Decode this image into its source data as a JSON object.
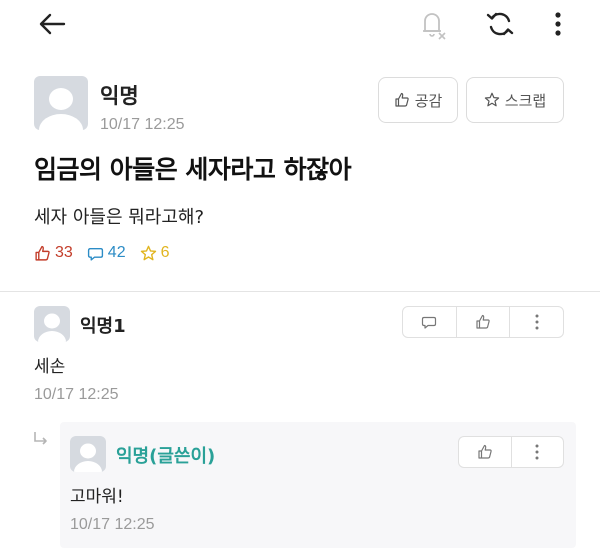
{
  "post": {
    "author": "익명",
    "time": "10/17 12:25",
    "title": "임금의 아들은 세자라고 하잖아",
    "body": "세자 아들은 뭐라고해?",
    "like_label": "공감",
    "scrap_label": "스크랩",
    "stats": {
      "likes": "33",
      "comments": "42",
      "scraps": "6"
    }
  },
  "comments": [
    {
      "author": "익명1",
      "text": "세손",
      "time": "10/17 12:25",
      "reply": {
        "author": "익명(글쓴이)",
        "text": "고마워!",
        "time": "10/17 12:25"
      }
    }
  ],
  "icons": {
    "back": "arrow-left-icon",
    "notifications": "bell-off-icon",
    "refresh": "refresh-icon",
    "more": "more-vertical-icon"
  },
  "colors": {
    "like": "#c33d2a",
    "comment": "#2c8cc6",
    "scrap": "#e1b520",
    "writer": "#2aa198",
    "muted": "#9a9a9a"
  }
}
